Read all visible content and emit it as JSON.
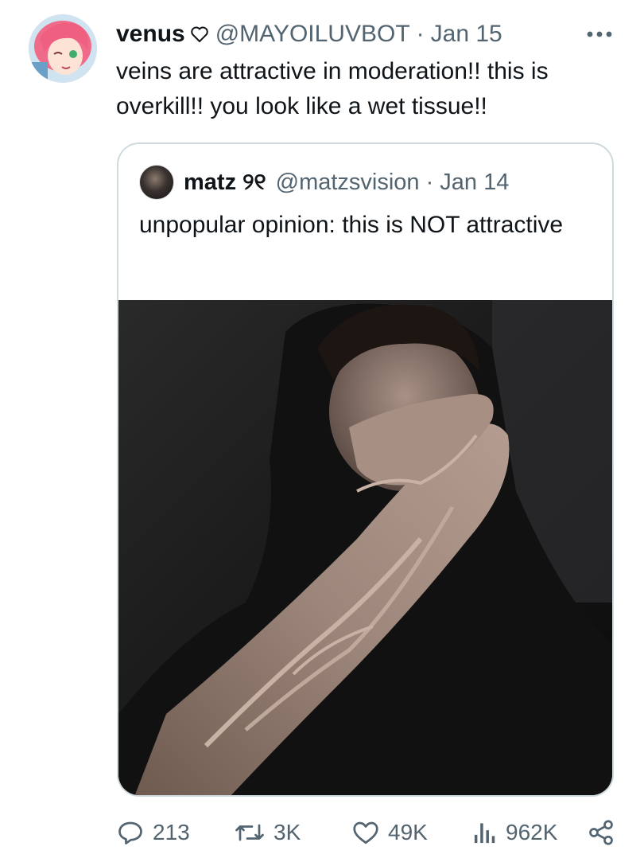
{
  "tweet": {
    "display_name": "venus",
    "handle": "@MAYOILUVBOT",
    "separator": "·",
    "date": "Jan 15",
    "text": "veins are attractive in moderation!! this is overkill!! you look like a wet tissue!!"
  },
  "quoted_tweet": {
    "display_name": "matz",
    "name_decoration": "୨୧",
    "handle": "@matzsvision",
    "separator": "·",
    "date": "Jan 14",
    "text": "unpopular opinion: this is NOT attractive"
  },
  "actions": {
    "replies": "213",
    "retweets": "3K",
    "likes": "49K",
    "views": "962K"
  },
  "icons": [
    "more-icon",
    "heart-outline-icon",
    "reply-icon",
    "retweet-icon",
    "like-icon",
    "views-icon",
    "share-icon"
  ],
  "colors": {
    "text": "#0f1419",
    "secondary": "#536471",
    "border": "#cfd9de"
  }
}
